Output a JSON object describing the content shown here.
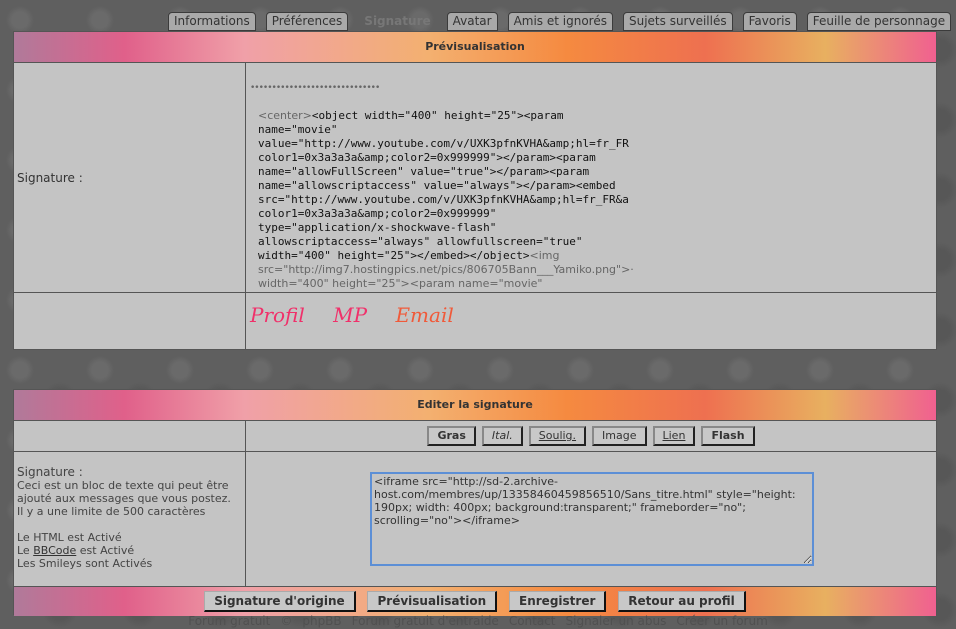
{
  "tabs": [
    "Informations",
    "Préférences",
    "Signature",
    "Avatar",
    "Amis et ignorés",
    "Sujets surveillés",
    "Favoris",
    "Feuille de personnage"
  ],
  "preview": {
    "title": "Prévisualisation",
    "label": "Signature :",
    "dots": "••••••••••••••••••••••••••••••",
    "code": [
      [
        "<center>",
        "<object width=\"400\" height=\"25\"><param"
      ],
      [
        "",
        "name=\"movie\""
      ],
      [
        "",
        "value=\"http://www.youtube.com/v/UXK3pfnKVHA&amp;hl=fr_FR"
      ],
      [
        "",
        "color1=0x3a3a3a&amp;color2=0x999999\"></param><param"
      ],
      [
        "",
        "name=\"allowFullScreen\" value=\"true\"></param><param"
      ],
      [
        "",
        "name=\"allowscriptaccess\" value=\"always\"></param><embed"
      ],
      [
        "",
        "src=\"http://www.youtube.com/v/UXK3pfnKVHA&amp;hl=fr_FR&a"
      ],
      [
        "",
        "color1=0x3a3a3a&amp;color2=0x999999\""
      ],
      [
        "",
        "type=\"application/x-shockwave-flash\""
      ],
      [
        "",
        "allowscriptaccess=\"always\" allowfullscreen=\"true\""
      ]
    ],
    "code_last": "width=\"400\" height=\"25\"></embed></object>",
    "code_last_gray": "<img",
    "gray_lines": [
      "src=\"http://img7.hostingpics.net/pics/806705Bann___Yamiko.png\">·",
      "width=\"400\" height=\"25\"><param name=\"movie\""
    ],
    "links": [
      "Profil",
      "MP",
      "Email"
    ]
  },
  "edit": {
    "title": "Editer la signature",
    "toolbar": [
      "Gras",
      "Ital.",
      "Soulig.",
      "Image",
      "Lien",
      "Flash"
    ],
    "label": "Signature :",
    "desc": [
      "Ceci est un bloc de texte qui peut être",
      "ajouté aux messages que vous postez.",
      "Il y a une limite de 500 caractères"
    ],
    "html_status": "Le HTML est Activé",
    "bbcode_prefix": "Le",
    "bbcode_link": "BBCode",
    "bbcode_suffix": "est Activé",
    "smileys_status": "Les Smileys sont Activés",
    "textarea": "<iframe src=\"http://sd-2.archive-host.com/membres/up/13358460459856510/Sans_titre.html\" style=\"height: 190px; width: 400px; background:transparent;\" frameborder=\"no\"; scrolling=\"no\"></iframe>",
    "buttons": [
      "Signature d'origine",
      "Prévisualisation",
      "Enregistrer",
      "Retour au profil"
    ]
  },
  "footer": [
    "Forum gratuit",
    "©",
    "phpBB",
    "Forum gratuit d'entraide",
    "Contact",
    "Signaler un abus",
    "Créer un forum"
  ],
  "colors": {
    "link_pink": "#f0306a",
    "link_orange": "#f05a3a",
    "focus_border": "#5c8fd6"
  }
}
